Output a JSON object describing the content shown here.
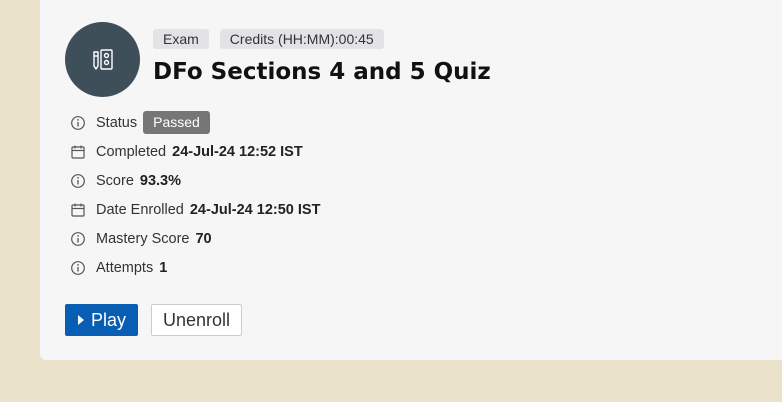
{
  "item": {
    "type_badge": "Exam",
    "credits_badge": "Credits (HH:MM):00:45",
    "title": "DFo Sections 4 and 5 Quiz"
  },
  "fields": {
    "status": {
      "label": "Status",
      "value": "Passed",
      "icon": "info-icon"
    },
    "completed": {
      "label": "Completed",
      "value": "24-Jul-24 12:52 IST",
      "icon": "calendar-icon"
    },
    "score": {
      "label": "Score",
      "value": "93.3%",
      "icon": "info-icon"
    },
    "date_enrolled": {
      "label": "Date Enrolled",
      "value": "24-Jul-24 12:50 IST",
      "icon": "calendar-icon"
    },
    "mastery_score": {
      "label": "Mastery Score",
      "value": "70",
      "icon": "info-icon"
    },
    "attempts": {
      "label": "Attempts",
      "value": "1",
      "icon": "info-icon"
    }
  },
  "actions": {
    "play_label": "Play",
    "unenroll_label": "Unenroll"
  },
  "colors": {
    "page_background": "#ebe2cb",
    "card_background": "#f6f6f7",
    "avatar_background": "#3f4f5a",
    "status_pill": "#767676",
    "primary_button": "#075eb3"
  }
}
